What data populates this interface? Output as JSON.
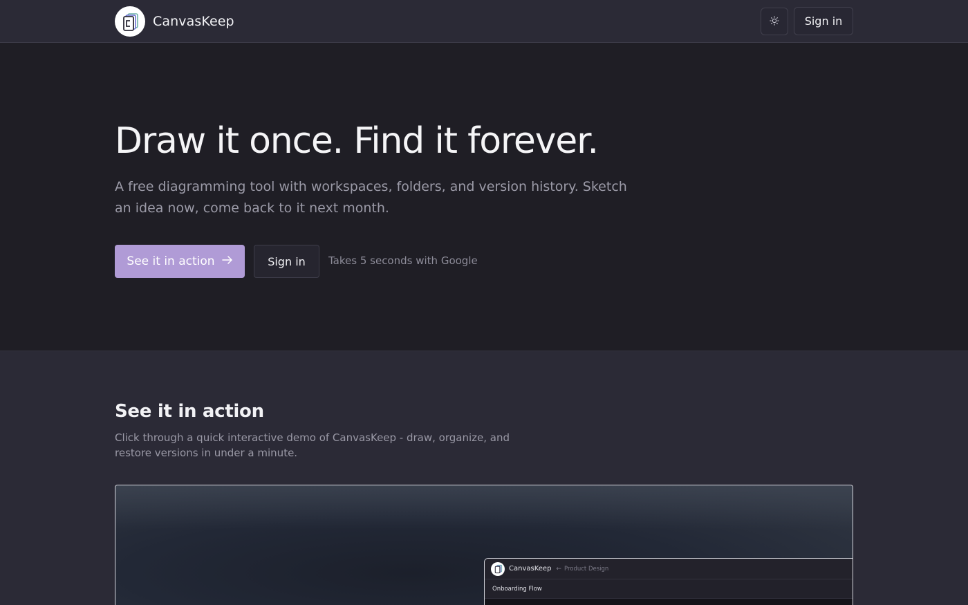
{
  "header": {
    "brand": "CanvasKeep",
    "signin_label": "Sign in",
    "logo_icon": "layered-pages-icon",
    "theme_icon": "sun-icon"
  },
  "hero": {
    "title": "Draw it once. Find it forever.",
    "subtitle": "A free diagramming tool with workspaces, folders, and version history. Sketch an idea now, come back to it next month.",
    "cta_primary": "See it in action",
    "cta_primary_icon": "arrow-right-icon",
    "cta_secondary": "Sign in",
    "note": "Takes 5 seconds with Google"
  },
  "demo": {
    "title": "See it in action",
    "description": "Click through a quick interactive demo of CanvasKeep - draw, organize, and restore versions in under a minute.",
    "preview": {
      "brand": "CanvasKeep",
      "back_icon": "←",
      "breadcrumb": "Product Design",
      "document_title": "Onboarding Flow"
    }
  },
  "colors": {
    "accent": "#b09bd6",
    "header_bg": "#2b2a36",
    "hero_bg": "#1f1e25",
    "section_bg": "#2b2a36"
  }
}
